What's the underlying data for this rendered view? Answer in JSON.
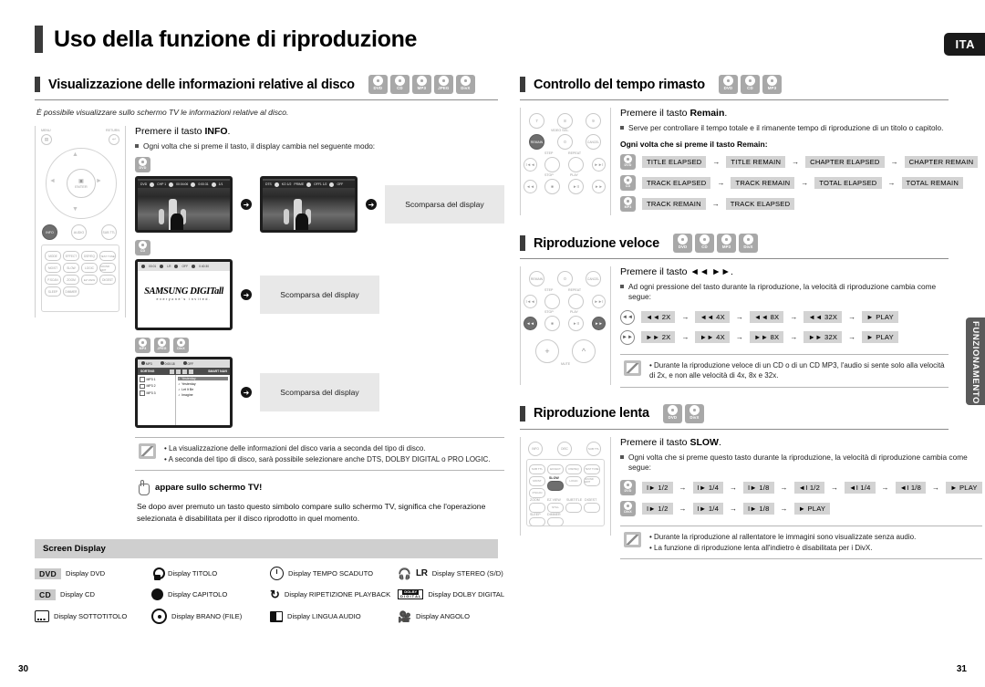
{
  "document": {
    "main_title": "Uso della funzione di riproduzione",
    "language_tab": "ITA",
    "side_tab": "FUNZIONAMENTO",
    "page_left": "30",
    "page_right": "31"
  },
  "disc_badges": {
    "dvd": "DVD",
    "cd": "CD",
    "mp3": "MP3",
    "jpeg": "JPEG",
    "divx": "DivX"
  },
  "section_info": {
    "title": "Visualizzazione delle informazioni relative al disco",
    "badges": [
      "DVD",
      "CD",
      "MP3",
      "JPEG",
      "DivX"
    ],
    "intro": "È possibile visualizzare sullo schermo TV le informazioni relative al disco.",
    "step_prefix": "Premere il tasto ",
    "step_key": "INFO",
    "step_suffix": ".",
    "bullet": "Ogni volta che si preme il tasto, il display cambia nel seguente modo:",
    "vanish_label": "Scomparsa del display",
    "osd1": [
      "DVD",
      "CHP 1",
      "00:04:06",
      "0:00:31",
      "1/1"
    ],
    "osd2": [
      "DTS",
      "KO 1/2",
      "PRIME",
      "OFF1 1/2",
      "OFF"
    ],
    "cd_osd": [
      "00:01",
      "LR",
      "OFF",
      "0:40:30"
    ],
    "samsung_line1": "SAMSUNG DIGIT",
    "samsung_line1_italic": "all",
    "samsung_line2": "everyone's invited.",
    "mp3_top": [
      "MP3",
      "0:00:18",
      "OFF"
    ],
    "mp3_bar_left": "SORTING",
    "mp3_bar_right": "SMART NAVI",
    "mp3_files": [
      "MP3 1",
      "MP3 2",
      "MP3 3"
    ],
    "mp3_tracks": [
      "Yesterday",
      "Yesterday",
      "Let It Be",
      "Imagine"
    ],
    "notes": [
      "La visualizzazione delle informazioni del disco varia a seconda del tipo di disco.",
      "A seconda del tipo di disco, sarà possibile selezionare anche DTS, DOLBY DIGITAL o PRO LOGIC."
    ],
    "hand_title": "appare sullo schermo TV!",
    "hand_body": "Se dopo aver premuto un tasto questo simbolo compare sullo schermo TV, significa che l'operazione selezionata è disabilitata per il disco riprodotto in quel momento."
  },
  "screen_display": {
    "heading": "Screen Display",
    "items": [
      {
        "icon": "dvd-tag",
        "tag": "DVD",
        "label": "Display DVD"
      },
      {
        "icon": "title-icon",
        "tag": "",
        "label": "Display TITOLO"
      },
      {
        "icon": "clock-icon",
        "tag": "",
        "label": "Display TEMPO SCADUTO"
      },
      {
        "icon": "headphone-lr-icon",
        "tag": "LR",
        "label": "Display STEREO (S/D)"
      },
      {
        "icon": "cd-tag",
        "tag": "CD",
        "label": "Display CD"
      },
      {
        "icon": "chapter-icon",
        "tag": "",
        "label": "Display CAPITOLO"
      },
      {
        "icon": "repeat-icon",
        "tag": "",
        "label": "Display RIPETIZIONE PLAYBACK"
      },
      {
        "icon": "dolby-digital-icon",
        "tag": "",
        "label": "Display DOLBY DIGITAL"
      },
      {
        "icon": "subtitle-icon",
        "tag": "",
        "label": "Display SOTTOTITOLO"
      },
      {
        "icon": "track-icon",
        "tag": "",
        "label": "Display BRANO (FILE)"
      },
      {
        "icon": "audio-language-icon",
        "tag": "",
        "label": "Display LINGUA AUDIO"
      },
      {
        "icon": "angle-camera-icon",
        "tag": "",
        "label": "Display ANGOLO"
      }
    ]
  },
  "section_remain": {
    "title": "Controllo del tempo rimasto",
    "badges": [
      "DVD",
      "CD",
      "MP3"
    ],
    "step_prefix": "Premere il tasto ",
    "step_key": "Remain",
    "step_suffix": ".",
    "bullet": "Serve per controllare il tempo totale e il rimanente tempo di riproduzione di un titolo o capitolo.",
    "sub_lead": "Ogni volta che si preme il tasto Remain:",
    "sequences": [
      {
        "badge": "DVD",
        "steps": [
          "TITLE ELAPSED",
          "TITLE REMAIN",
          "CHAPTER ELAPSED",
          "CHAPTER REMAIN"
        ]
      },
      {
        "badge": "CD",
        "steps": [
          "TRACK ELAPSED",
          "TRACK REMAIN",
          "TOTAL ELAPSED",
          "TOTAL REMAIN"
        ]
      },
      {
        "badge": "MP3",
        "steps": [
          "TRACK REMAIN",
          "TRACK ELAPSED"
        ]
      }
    ],
    "remote_labels": [
      "7",
      "8",
      "9",
      "VIDEO SEL.",
      "REMAIN",
      "0",
      "CANCEL",
      "STEP",
      "REPEAT",
      "STOP",
      "PLAY"
    ]
  },
  "section_fast": {
    "title": "Riproduzione veloce",
    "badges": [
      "DVD",
      "CD",
      "MP3",
      "DivX"
    ],
    "step_prefix": "Premere il tasto ",
    "step_key": "◄◄ ►►",
    "step_suffix": ".",
    "bullet": "Ad ogni pressione del tasto durante la riproduzione, la velocità di riproduzione cambia come segue:",
    "sequences": [
      {
        "key": "◄◄",
        "steps": [
          "◄◄ 2X",
          "◄◄ 4X",
          "◄◄ 8X",
          "◄◄ 32X",
          "► PLAY"
        ]
      },
      {
        "key": "►►",
        "steps": [
          "►► 2X",
          "►► 4X",
          "►► 8X",
          "►► 32X",
          "► PLAY"
        ]
      }
    ],
    "notes": [
      "Durante la riproduzione veloce di un CD o di un CD MP3, l'audio si sente solo alla velocità di 2x, e non alle velocità di 4x, 8x e 32x."
    ],
    "remote_labels": [
      "REMAIN",
      "0",
      "CANCEL",
      "STEP",
      "REPEAT",
      "STOP",
      "PLAY",
      "MUTE"
    ]
  },
  "section_slow": {
    "title": "Riproduzione lenta",
    "badges": [
      "DVD",
      "DivX"
    ],
    "step_prefix": "Premere il tasto ",
    "step_key": "SLOW",
    "step_suffix": ".",
    "bullet": "Ogni volta che si preme questo tasto durante la riproduzione, la velocità di riproduzione cambia come segue:",
    "sequences": [
      {
        "badge": "DVD",
        "steps": [
          "I► 1/2",
          "I► 1/4",
          "I► 1/8",
          "◄I 1/2",
          "◄I 1/4",
          "◄I 1/8",
          "► PLAY"
        ]
      },
      {
        "badge": "DivX",
        "steps": [
          "I► 1/2",
          "I► 1/4",
          "I► 1/8",
          "► PLAY"
        ]
      }
    ],
    "notes": [
      "Durante la riproduzione al rallentatore le immagini sono visualizzate senza audio.",
      "La funzione di riproduzione lenta all'indietro è disabilitata per i DivX."
    ],
    "remote_labels": [
      "INFO",
      "DISC",
      "SUB TTL",
      "MODE",
      "EFFECT",
      "DSP/EQ",
      "TEST TONE",
      "MO/ST",
      "SLOW",
      "LOGIC",
      "SOUND EDIT",
      "P.SCAN",
      "ZOOM",
      "EZ VIEW",
      "SUBTITLE",
      "DIGEST",
      "STILL",
      "SLEEP",
      "DIMMER"
    ]
  },
  "remote_main": {
    "labels": [
      "MENU",
      "RETURN",
      "ENTER",
      "INFO",
      "AUDIO",
      "SUB TTL",
      "MODE",
      "EFFECT",
      "DSP/EQ",
      "TEST TONE",
      "MO/ST",
      "SLOW",
      "LOGIC",
      "SOUND EDIT",
      "P.SCAN",
      "ZOOM",
      "EZ VIEW",
      "SUBTITLE",
      "DIGEST",
      "STILL",
      "SLEEP",
      "DIMMER"
    ]
  }
}
